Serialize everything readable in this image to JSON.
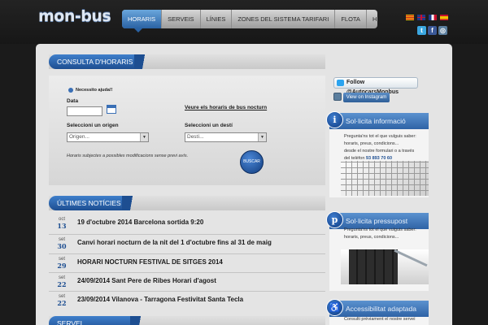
{
  "header": {
    "logo": "mon-bus",
    "nav": [
      "HORARIS",
      "SERVEIS",
      "LÍNIES",
      "ZONES DEL SISTEMA TARIFARI",
      "FLOTA",
      "HISTÒRIA"
    ],
    "active_nav": "HORARIS",
    "flag_icons": [
      "catalan-flag-icon",
      "uk-flag-icon",
      "france-flag-icon",
      "spain-flag-icon"
    ],
    "social_icons": [
      "twitter-icon",
      "facebook-icon",
      "instagram-icon"
    ]
  },
  "consulta": {
    "title": "CONSULTA D'HORARIS",
    "help": "Necessito ajuda!!",
    "date_label": "Data",
    "night_link": "Veure els horaris de bus nocturn",
    "origin_label": "Seleccioni un origen",
    "origin_value": "Origen...",
    "dest_label": "Seleccioni un destí",
    "dest_value": "Destí...",
    "note": "Horaris subjectes a possibles modificacions sense previ avís.",
    "search_label": "BUSCAR"
  },
  "news": {
    "title": "ÚLTIMES NOTÍCIES",
    "items": [
      {
        "month": "oct",
        "day": "13",
        "title": "19 d'octubre 2014 Barcelona sortida 9:20"
      },
      {
        "month": "set",
        "day": "30",
        "title": "Canvi horari nocturn de la nit del 1 d'octubre fins al 31 de maig"
      },
      {
        "month": "set",
        "day": "29",
        "title": "HORARI NOCTURN FESTIVAL DE SITGES 2014"
      },
      {
        "month": "set",
        "day": "22",
        "title": "24/09/2014 Sant Pere de Ribes Horari d'agost"
      },
      {
        "month": "set",
        "day": "22",
        "title": "23/09/2014 Vilanova - Tarragona Festivitat Santa Tecla"
      }
    ]
  },
  "servei": {
    "title": "SERVEI DISCRECIONAL"
  },
  "sidebar": {
    "follow": "Follow @AutocarsMonbus",
    "instagram": "View on Instagram",
    "info": {
      "badge": "i",
      "title": "Sol·licita informació",
      "line1": "Pregunta'ns tot el que vulguis saber:",
      "line2": "horaris, preus, condicions...",
      "line3": "desde el nostre formulari o a través",
      "line4_prefix": "del telèfon",
      "phone": "93 893 70 60"
    },
    "budget": {
      "badge": "p",
      "title": "Sol·licita pressupost",
      "line1": "Pregunta'ns tot el que vulguis saber:",
      "line2": "horaris, preus, condicions..."
    },
    "access": {
      "badge": "♿",
      "title": "Accessibilitat adaptada",
      "line1": "Consulti prèviament el nostre servei"
    }
  }
}
